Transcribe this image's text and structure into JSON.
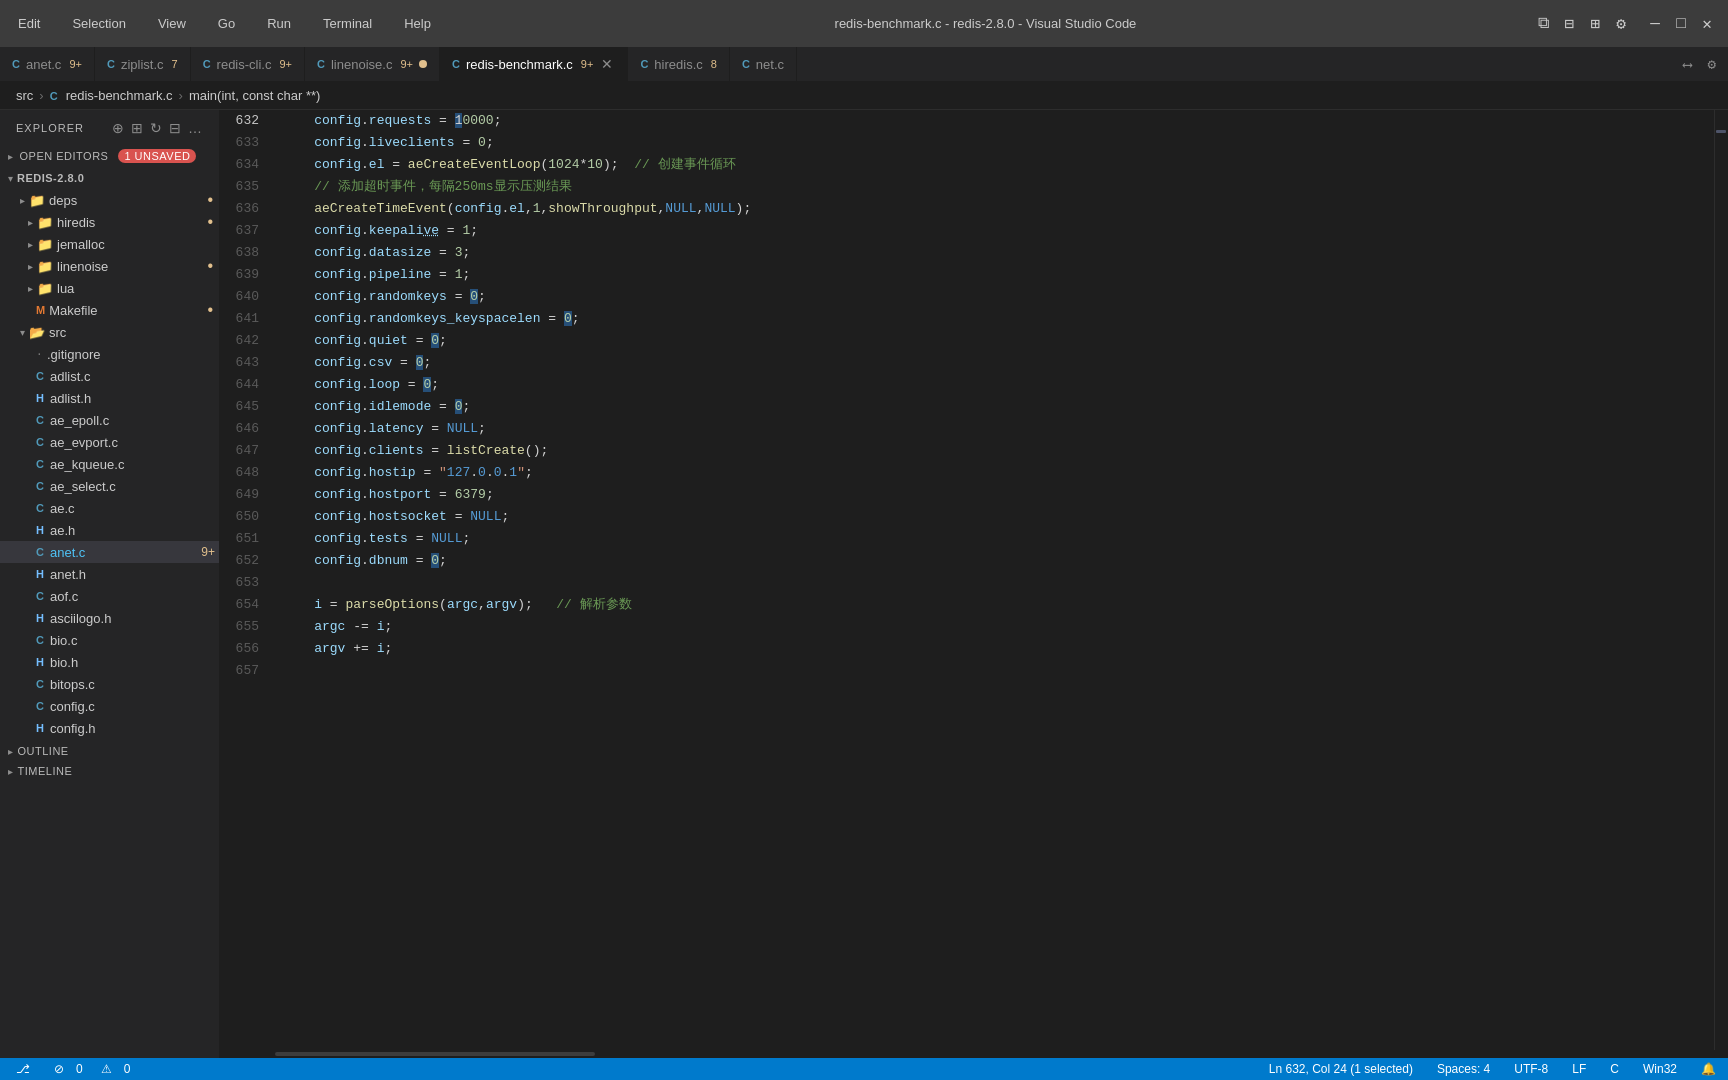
{
  "titlebar": {
    "menu": [
      "Edit",
      "Selection",
      "View",
      "Go",
      "Run",
      "Terminal",
      "Help"
    ],
    "title": "redis-benchmark.c - redis-2.8.0 - Visual Studio Code",
    "window_controls": [
      "⧉",
      "—",
      "□",
      "✕"
    ]
  },
  "tabs": [
    {
      "id": "anet",
      "icon": "C",
      "label": "anet.c",
      "badge": "9+",
      "active": false,
      "dot": false,
      "modified": false
    },
    {
      "id": "ziplist",
      "icon": "C",
      "label": "ziplist.c",
      "badge": "7",
      "active": false,
      "dot": false,
      "modified": false
    },
    {
      "id": "redis-cli",
      "icon": "C",
      "label": "redis-cli.c",
      "badge": "9+",
      "active": false,
      "dot": false,
      "modified": false
    },
    {
      "id": "linenoise",
      "icon": "C",
      "label": "linenoise.c",
      "badge": "9+",
      "active": false,
      "dot": true,
      "modified": false
    },
    {
      "id": "redis-benchmark",
      "icon": "C",
      "label": "redis-benchmark.c",
      "badge": "9+",
      "active": true,
      "dot": false,
      "modified": false,
      "closeable": true
    },
    {
      "id": "hiredis",
      "icon": "C",
      "label": "hiredis.c",
      "badge": "8",
      "active": false,
      "dot": false,
      "modified": false
    },
    {
      "id": "net",
      "icon": "C",
      "label": "net.c",
      "badge": "",
      "active": false,
      "dot": false,
      "modified": false
    }
  ],
  "breadcrumb": {
    "parts": [
      "src",
      "redis-benchmark.c",
      "main(int, const char **)"
    ]
  },
  "sidebar": {
    "explorer_label": "EXPLORER",
    "open_editors_label": "OPEN EDITORS",
    "unsaved_count": "1 UNSAVED",
    "project_label": "REDIS-2.8.0",
    "folders": [
      {
        "name": "deps",
        "indent": 0,
        "dot": true,
        "type": "folder",
        "expanded": false
      },
      {
        "name": "hiredis",
        "indent": 1,
        "dot": true,
        "type": "folder",
        "expanded": false
      },
      {
        "name": "jemalloc",
        "indent": 1,
        "dot": false,
        "type": "folder",
        "expanded": false
      },
      {
        "name": "linenoise",
        "indent": 1,
        "dot": true,
        "type": "folder",
        "expanded": false
      },
      {
        "name": "lua",
        "indent": 1,
        "dot": false,
        "type": "folder",
        "expanded": false
      },
      {
        "name": "Makefile",
        "indent": 1,
        "dot": true,
        "type": "file",
        "expanded": false
      }
    ],
    "src_folder": {
      "name": "src",
      "expanded": true
    },
    "files": [
      {
        "name": ".gitignore",
        "icon": "none",
        "indent": 1
      },
      {
        "name": "adlist.c",
        "icon": "C",
        "indent": 1
      },
      {
        "name": "adlist.h",
        "icon": "H",
        "indent": 1
      },
      {
        "name": "ae_epoll.c",
        "icon": "C",
        "indent": 1
      },
      {
        "name": "ae_evport.c",
        "icon": "C",
        "indent": 1
      },
      {
        "name": "ae_kqueue.c",
        "icon": "C",
        "indent": 1
      },
      {
        "name": "ae_select.c",
        "icon": "C",
        "indent": 1
      },
      {
        "name": "ae.c",
        "icon": "C",
        "indent": 1
      },
      {
        "name": "ae.h",
        "icon": "H",
        "indent": 1
      },
      {
        "name": "anet.c",
        "icon": "C",
        "indent": 1,
        "badge": "9+"
      },
      {
        "name": "anet.h",
        "icon": "H",
        "indent": 1
      },
      {
        "name": "aof.c",
        "icon": "C",
        "indent": 1
      },
      {
        "name": "asciilogo.h",
        "icon": "H",
        "indent": 1
      },
      {
        "name": "bio.c",
        "icon": "C",
        "indent": 1
      },
      {
        "name": "bio.h",
        "icon": "H",
        "indent": 1
      },
      {
        "name": "bitops.c",
        "icon": "C",
        "indent": 1
      },
      {
        "name": "config.c",
        "icon": "C",
        "indent": 1
      },
      {
        "name": "config.h",
        "icon": "H",
        "indent": 1
      }
    ],
    "outline_label": "OUTLINE",
    "timeline_label": "TIMELINE"
  },
  "code": {
    "lines": [
      {
        "num": 632,
        "content": "    config.requests = 10000;",
        "tokens": [
          {
            "text": "    ",
            "class": ""
          },
          {
            "text": "config",
            "class": "var"
          },
          {
            "text": ".",
            "class": "punc"
          },
          {
            "text": "requests",
            "class": "prop"
          },
          {
            "text": " = ",
            "class": "op"
          },
          {
            "text": "1",
            "class": "sel-bg-char"
          },
          {
            "text": "0000",
            "class": "num"
          },
          {
            "text": ";",
            "class": "punc"
          }
        ]
      },
      {
        "num": 633,
        "content": "    config.liveclients = 0;"
      },
      {
        "num": 634,
        "content": "    config.el = aeCreateEventLoop(1024*10);  // 创建事件循环"
      },
      {
        "num": 635,
        "content": "    // 添加超时事件，每隔250ms显示压测结果"
      },
      {
        "num": 636,
        "content": "    aeCreateTimeEvent(config.el,1,showThroughput,NULL,NULL);"
      },
      {
        "num": 637,
        "content": "    config.keepalive = 1;"
      },
      {
        "num": 638,
        "content": "    config.datasize = 3;"
      },
      {
        "num": 639,
        "content": "    config.pipeline = 1;"
      },
      {
        "num": 640,
        "content": "    config.randomkeys = 0;"
      },
      {
        "num": 641,
        "content": "    config.randomkeys_keyspacelen = 0;"
      },
      {
        "num": 642,
        "content": "    config.quiet = 0;"
      },
      {
        "num": 643,
        "content": "    config.csv = 0;"
      },
      {
        "num": 644,
        "content": "    config.loop = 0;"
      },
      {
        "num": 645,
        "content": "    config.idlemode = 0;"
      },
      {
        "num": 646,
        "content": "    config.latency = NULL;"
      },
      {
        "num": 647,
        "content": "    config.clients = listCreate();"
      },
      {
        "num": 648,
        "content": "    config.hostip = \"127.0.0.1\";"
      },
      {
        "num": 649,
        "content": "    config.hostport = 6379;"
      },
      {
        "num": 650,
        "content": "    config.hostsocket = NULL;"
      },
      {
        "num": 651,
        "content": "    config.tests = NULL;"
      },
      {
        "num": 652,
        "content": "    config.dbnum = 0;"
      },
      {
        "num": 653,
        "content": ""
      },
      {
        "num": 654,
        "content": "    i = parseOptions(argc,argv);  // 解析参数"
      },
      {
        "num": 655,
        "content": "    argc -= i;"
      },
      {
        "num": 656,
        "content": "    argv += i;"
      },
      {
        "num": 657,
        "content": ""
      }
    ]
  },
  "statusbar": {
    "left": {
      "git_icon": "⎇",
      "git_branch": "",
      "error_count": "0",
      "warning_count": "0"
    },
    "right": {
      "position": "Ln 632, Col 24 (1 selected)",
      "spaces": "Spaces: 4",
      "encoding": "UTF-8",
      "line_endings": "LF",
      "language": "C",
      "os": "Win32"
    }
  }
}
